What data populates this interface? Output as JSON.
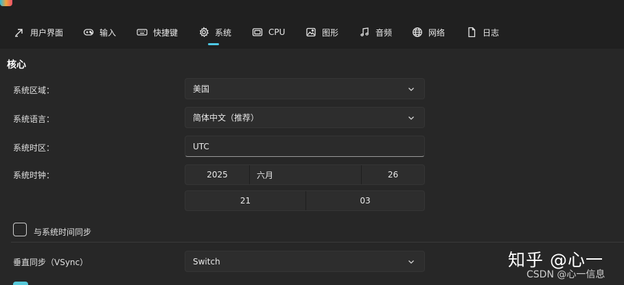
{
  "tabs": [
    {
      "label": "用户界面",
      "icon": "cursor-pointer-icon"
    },
    {
      "label": "输入",
      "icon": "gamepad-icon"
    },
    {
      "label": "快捷键",
      "icon": "keyboard-icon"
    },
    {
      "label": "系统",
      "icon": "gear-icon",
      "selected": true
    },
    {
      "label": "CPU",
      "icon": "cpu-chip-icon"
    },
    {
      "label": "图形",
      "icon": "image-icon"
    },
    {
      "label": "音频",
      "icon": "music-note-icon"
    },
    {
      "label": "网络",
      "icon": "globe-icon"
    },
    {
      "label": "日志",
      "icon": "document-icon"
    }
  ],
  "accent_color": "#4ec9e6",
  "section": {
    "title": "核心"
  },
  "region": {
    "label": "系统区域：",
    "value": "美国"
  },
  "language": {
    "label": "系统语言：",
    "value": "简体中文（推荐）"
  },
  "timezone": {
    "label": "系统时区：",
    "value": "UTC"
  },
  "clock": {
    "label": "系统时钟：",
    "year": "2025",
    "month": "六月",
    "day": "26",
    "hour": "21",
    "minute": "03"
  },
  "sync_time": {
    "label": "与系统时间同步",
    "checked": false
  },
  "vsync": {
    "label": "垂直同步（VSync）",
    "value": "Switch"
  },
  "watermark": {
    "line1": "知乎 @心一",
    "line2": "CSDN @心一信息"
  }
}
